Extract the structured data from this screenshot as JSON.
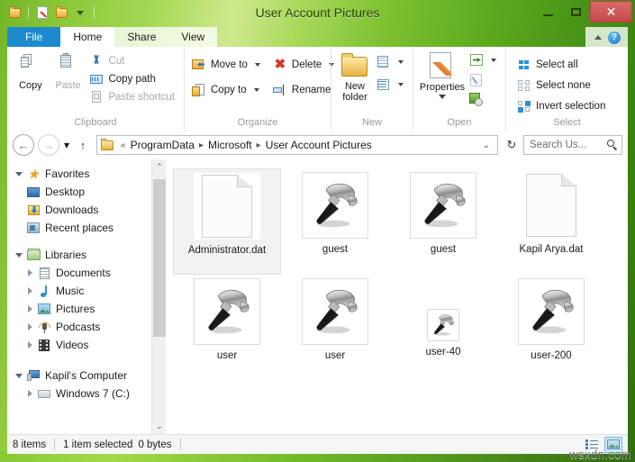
{
  "window": {
    "title": "User Account Pictures",
    "quick_access": [
      {
        "name": "folder-icon"
      },
      {
        "name": "properties-icon"
      },
      {
        "name": "new-folder-icon"
      },
      {
        "name": "customize-qat-caret"
      }
    ],
    "controls": {
      "minimize": "–",
      "maximize": "□",
      "close": "✕"
    }
  },
  "tabs": [
    {
      "label": "File",
      "state": "file"
    },
    {
      "label": "Home",
      "state": "active"
    },
    {
      "label": "Share",
      "state": "inactive"
    },
    {
      "label": "View",
      "state": "inactive"
    }
  ],
  "ribbon": {
    "collapse_icon": "chevron-up-icon",
    "help_icon": "?",
    "groups": [
      {
        "title": "Clipboard",
        "big_buttons": [
          {
            "label": "Copy",
            "icon": "copy-icon",
            "disabled": false
          },
          {
            "label": "Paste",
            "icon": "paste-icon",
            "disabled": true
          }
        ],
        "small_buttons": [
          {
            "label": "Cut",
            "icon": "scissors-icon",
            "disabled": true
          },
          {
            "label": "Copy path",
            "icon": "copy-path-icon",
            "disabled": false
          },
          {
            "label": "Paste shortcut",
            "icon": "paste-shortcut-icon",
            "disabled": true
          }
        ]
      },
      {
        "title": "Organize",
        "small_buttons": [
          {
            "label": "Move to",
            "icon": "move-to-icon",
            "caret": true
          },
          {
            "label": "Copy to",
            "icon": "copy-to-icon",
            "caret": true
          },
          {
            "label": "Delete",
            "icon": "delete-icon",
            "caret": true
          },
          {
            "label": "Rename",
            "icon": "rename-icon",
            "caret": false
          }
        ]
      },
      {
        "title": "New",
        "big_buttons": [
          {
            "label": "New\nfolder",
            "label_line1": "New",
            "label_line2": "folder",
            "icon": "new-folder-icon"
          }
        ],
        "split_buttons": [
          {
            "icon": "new-item-icon",
            "caret": true
          },
          {
            "icon": "easy-access-icon",
            "caret": true
          }
        ]
      },
      {
        "title": "Open",
        "big_buttons": [
          {
            "label": "Properties",
            "icon": "properties-icon",
            "caret": true
          }
        ],
        "split_buttons": [
          {
            "icon": "open-icon",
            "caret": true
          },
          {
            "icon": "edit-icon",
            "caret": false,
            "disabled": true
          },
          {
            "icon": "history-icon",
            "caret": false
          }
        ]
      },
      {
        "title": "Select",
        "small_buttons": [
          {
            "label": "Select all",
            "icon": "select-all-icon"
          },
          {
            "label": "Select none",
            "icon": "select-none-icon"
          },
          {
            "label": "Invert selection",
            "icon": "invert-selection-icon"
          }
        ]
      }
    ]
  },
  "address_bar": {
    "back_icon": "←",
    "forward_icon": "→",
    "history_caret": "▾",
    "up_icon": "↑",
    "folder_icon": "folder-icon",
    "overflow": "«",
    "crumbs": [
      "ProgramData",
      "Microsoft",
      "User Account Pictures"
    ],
    "crumb_separator": "▸",
    "dropdown_caret": "⌄",
    "refresh_icon": "↻",
    "search_placeholder": "Search Us...",
    "search_value": "",
    "search_icon": "magnifier-icon"
  },
  "sidebar": {
    "groups": [
      {
        "header": {
          "label": "Favorites",
          "icon": "star-icon",
          "expanded": true
        },
        "items": [
          {
            "label": "Desktop",
            "icon": "desktop-icon",
            "twist": "none"
          },
          {
            "label": "Downloads",
            "icon": "downloads-icon",
            "twist": "none"
          },
          {
            "label": "Recent places",
            "icon": "recent-places-icon",
            "twist": "none"
          }
        ]
      },
      {
        "header": {
          "label": "Libraries",
          "icon": "libraries-icon",
          "expanded": true
        },
        "items": [
          {
            "label": "Documents",
            "icon": "documents-icon",
            "twist": "closed"
          },
          {
            "label": "Music",
            "icon": "music-icon",
            "twist": "closed"
          },
          {
            "label": "Pictures",
            "icon": "pictures-icon",
            "twist": "closed"
          },
          {
            "label": "Podcasts",
            "icon": "podcasts-icon",
            "twist": "closed"
          },
          {
            "label": "Videos",
            "icon": "videos-icon",
            "twist": "closed"
          }
        ]
      },
      {
        "header": {
          "label": "Kapil's Computer",
          "icon": "computer-icon",
          "expanded": true
        },
        "items": [
          {
            "label": "Windows 7 (C:)",
            "icon": "drive-icon",
            "twist": "closed"
          }
        ]
      }
    ],
    "scroll_up_icon": "⌃",
    "scroll_down_icon": "⌄"
  },
  "files": [
    {
      "name": "Administrator.dat",
      "icon": "blank-document-icon",
      "selected": true
    },
    {
      "name": "guest",
      "icon": "hammer-icon",
      "selected": false,
      "size": "large"
    },
    {
      "name": "guest",
      "icon": "hammer-icon",
      "selected": false,
      "size": "large"
    },
    {
      "name": "Kapil Arya.dat",
      "icon": "blank-document-icon",
      "selected": false
    },
    {
      "name": "user",
      "icon": "hammer-icon",
      "selected": false,
      "size": "large"
    },
    {
      "name": "user",
      "icon": "hammer-icon",
      "selected": false,
      "size": "large"
    },
    {
      "name": "user-40",
      "icon": "hammer-icon",
      "selected": false,
      "size": "small"
    },
    {
      "name": "user-200",
      "icon": "hammer-icon",
      "selected": false,
      "size": "large"
    }
  ],
  "status_bar": {
    "item_count": "8 items",
    "selection": "1 item selected",
    "size": "0 bytes",
    "views": [
      {
        "name": "details-view",
        "active": false
      },
      {
        "name": "thumbnails-view",
        "active": true
      }
    ]
  },
  "watermark": "wsxdn.com",
  "colors": {
    "file_tab_blue": "#1d8ad0",
    "close_red": "#c44a4a",
    "frame_green": "#7cc42c",
    "selection_gray": "#f2f2f2"
  }
}
